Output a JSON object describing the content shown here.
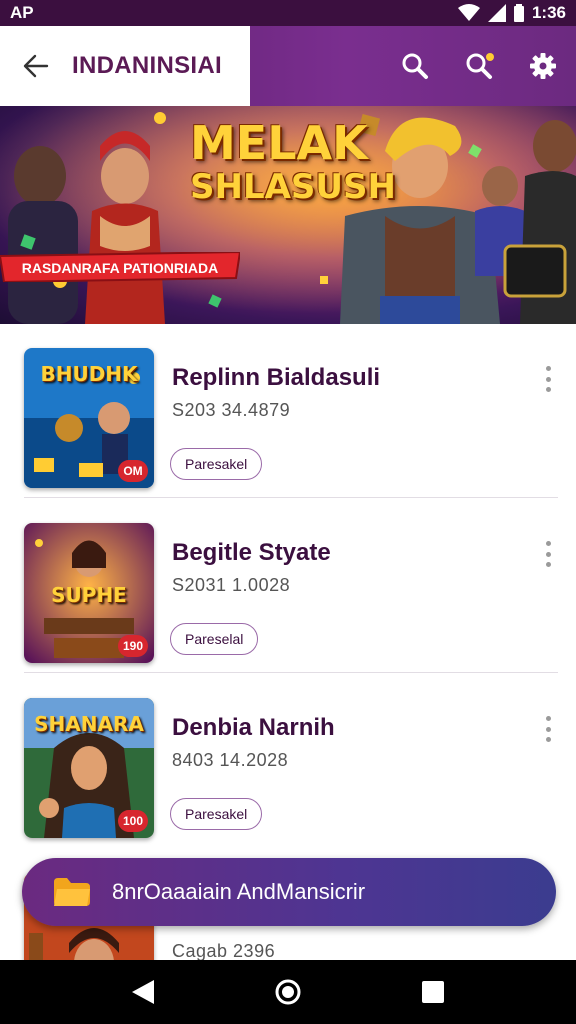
{
  "status_bar": {
    "carrier": "AP",
    "time": "1:36"
  },
  "app_bar": {
    "title": "INDANINSIAI",
    "icons": [
      "arrow-back-icon",
      "search-icon",
      "search-notification-icon",
      "gear-icon"
    ],
    "accent": "#6c2a80"
  },
  "hero": {
    "headline_line1": "MELAK",
    "headline_line2": "SHLASUSH",
    "ribbon": "RASDANRAFA PATIONRIADA"
  },
  "items": [
    {
      "thumb_title": "BHUDHK",
      "thumb_badge": "OM",
      "title": "Replinn Bialdasuli",
      "subtitle": "S203 34.4879",
      "chip": "Paresakel"
    },
    {
      "thumb_title": "SUPHE",
      "thumb_badge": "190",
      "title": "Begitle Styate",
      "subtitle": "S2031 1.0028",
      "chip": "Pareselal"
    },
    {
      "thumb_title": "SHANARA",
      "thumb_badge": "100",
      "title": "Denbia Narnih",
      "subtitle": "8403 14.2028",
      "chip": "Paresakel"
    },
    {
      "thumb_title": "",
      "thumb_badge": "",
      "title": "",
      "subtitle": "Cagab 2396",
      "chip": ""
    }
  ],
  "float_banner": {
    "icon": "folder-icon",
    "label": "8nrOaaaiain AndMansicrir"
  },
  "nav": {
    "icons": [
      "back-triangle-icon",
      "home-circle-icon",
      "recents-square-icon"
    ]
  }
}
